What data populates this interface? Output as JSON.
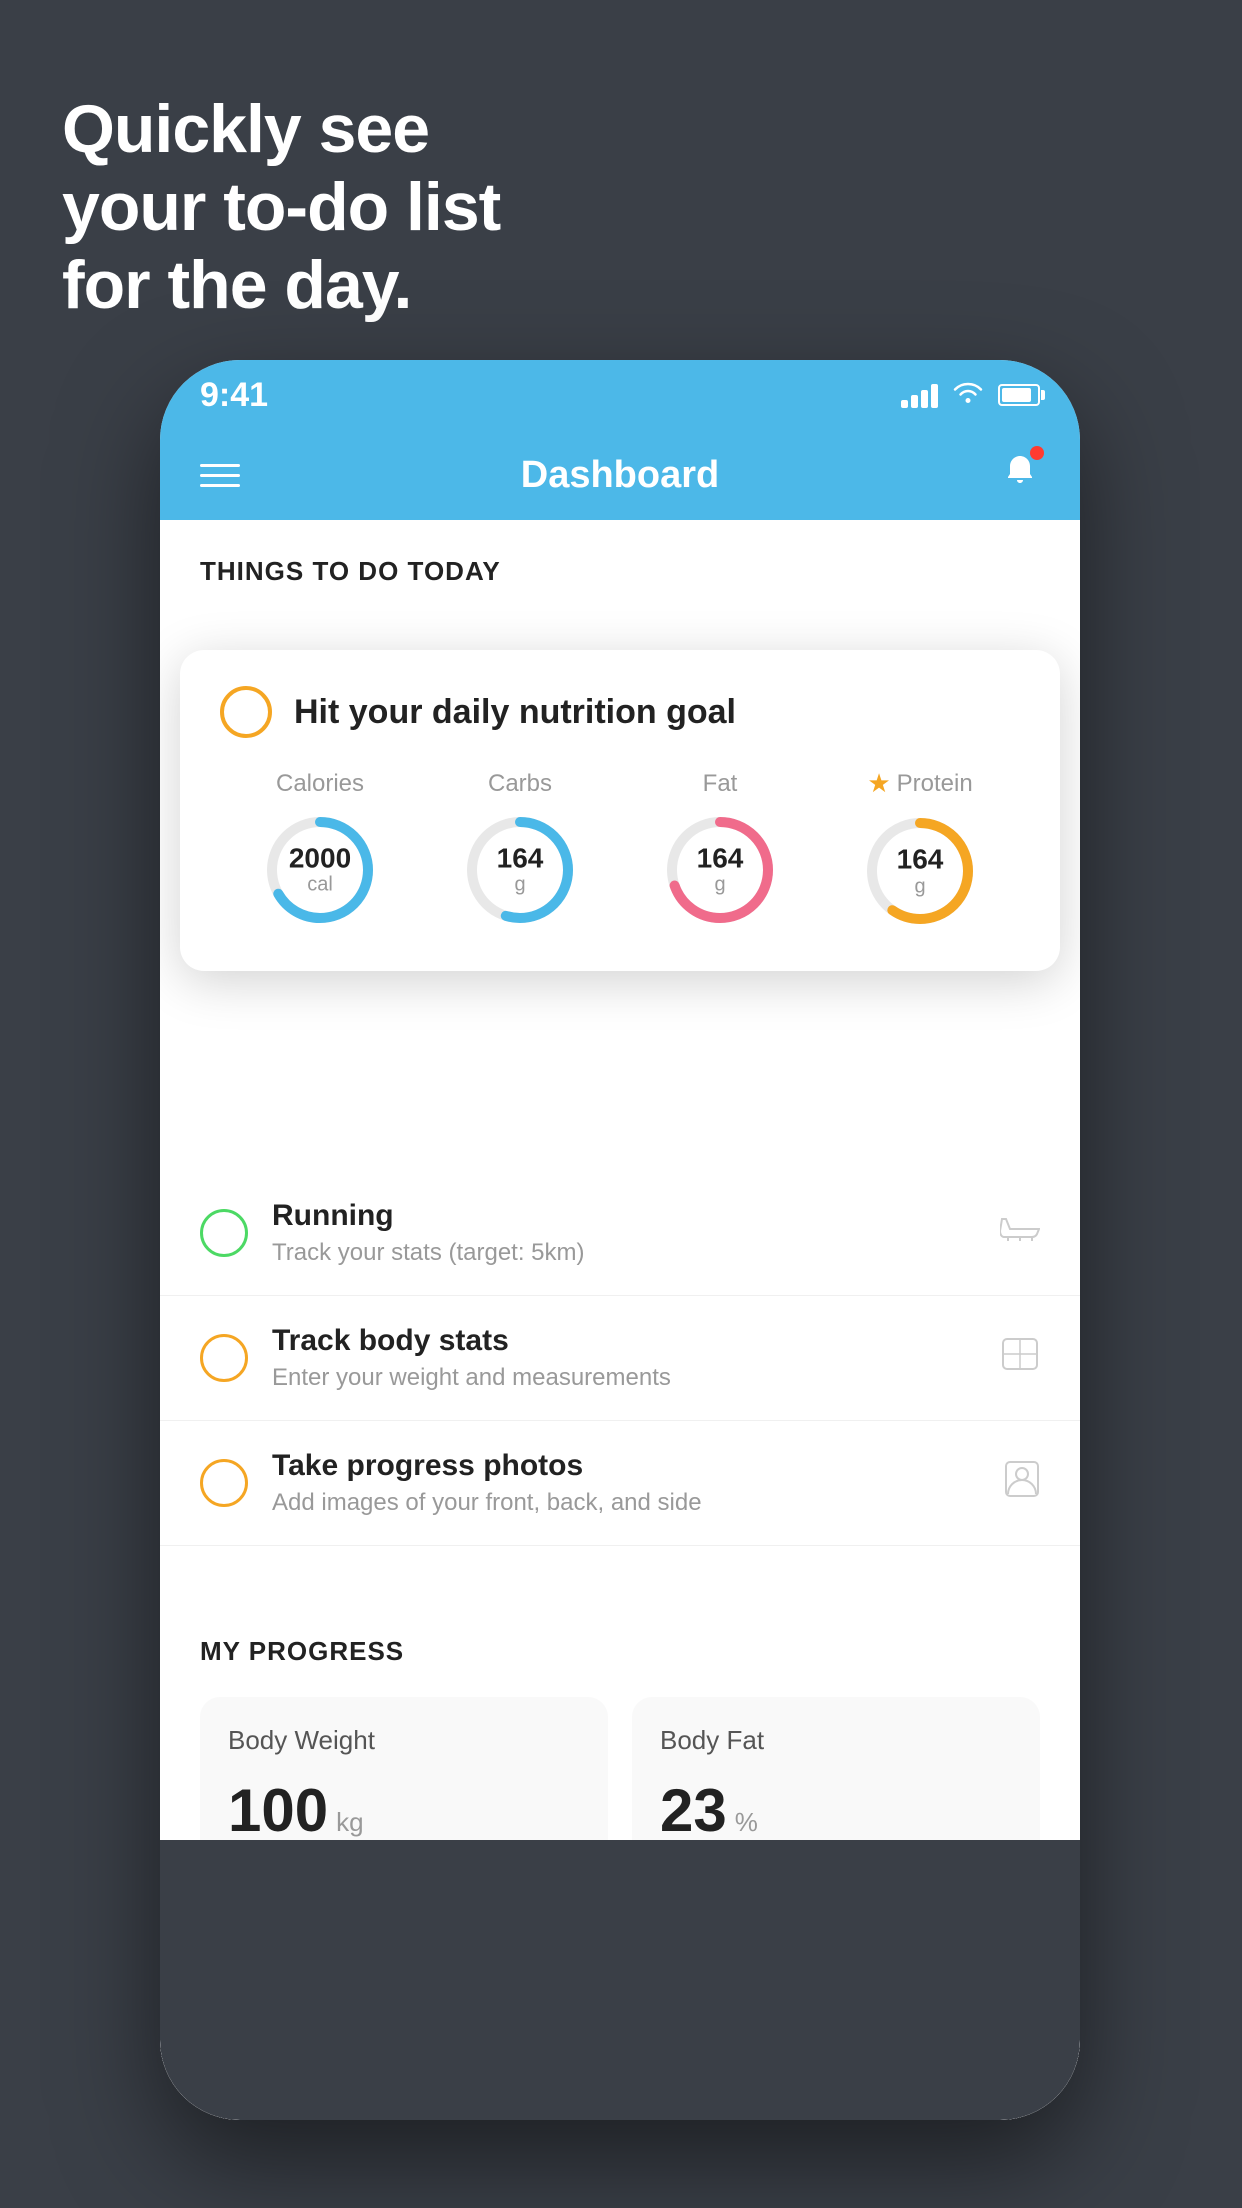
{
  "hero": {
    "line1": "Quickly see",
    "line2": "your to-do list",
    "line3": "for the day."
  },
  "statusBar": {
    "time": "9:41"
  },
  "navBar": {
    "title": "Dashboard"
  },
  "thingsSection": {
    "heading": "THINGS TO DO TODAY"
  },
  "nutritionCard": {
    "title": "Hit your daily nutrition goal",
    "nutrients": [
      {
        "label": "Calories",
        "value": "2000",
        "unit": "cal",
        "color": "#4ab8e8",
        "pct": 65,
        "starred": false
      },
      {
        "label": "Carbs",
        "value": "164",
        "unit": "g",
        "color": "#4ab8e8",
        "pct": 55,
        "starred": false
      },
      {
        "label": "Fat",
        "value": "164",
        "unit": "g",
        "color": "#f06b8b",
        "pct": 70,
        "starred": false
      },
      {
        "label": "Protein",
        "value": "164",
        "unit": "g",
        "color": "#f5a623",
        "pct": 60,
        "starred": true
      }
    ]
  },
  "todoItems": [
    {
      "title": "Running",
      "subtitle": "Track your stats (target: 5km)",
      "circleColor": "green",
      "icon": "shoe"
    },
    {
      "title": "Track body stats",
      "subtitle": "Enter your weight and measurements",
      "circleColor": "yellow",
      "icon": "scale"
    },
    {
      "title": "Take progress photos",
      "subtitle": "Add images of your front, back, and side",
      "circleColor": "yellow",
      "icon": "person"
    }
  ],
  "progressSection": {
    "heading": "MY PROGRESS",
    "cards": [
      {
        "title": "Body Weight",
        "value": "100",
        "unit": "kg"
      },
      {
        "title": "Body Fat",
        "value": "23",
        "unit": "%"
      }
    ]
  }
}
